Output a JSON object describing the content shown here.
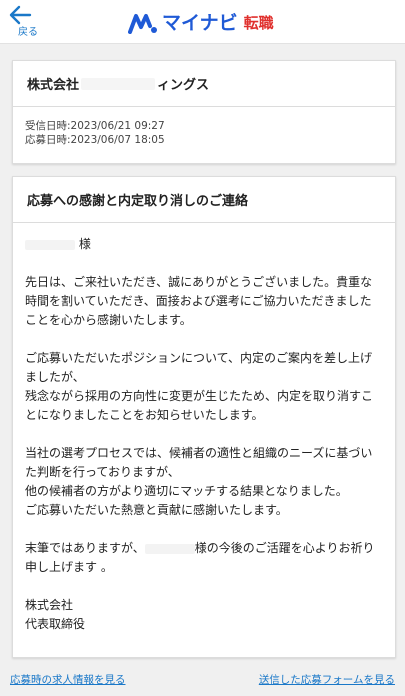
{
  "header": {
    "back_label": "戻る",
    "logo_brand": "マイナビ",
    "logo_sub": "転職",
    "brand_color": "#1f5ad6",
    "accent_color": "#e0302d",
    "icons": {
      "back": "arrow-left-icon",
      "logo": "mynavi-mark-icon"
    }
  },
  "summary": {
    "company_prefix": "株式会社",
    "company_suffix": "ィングス",
    "received_label": "受信日時:2023/06/21 09:27",
    "applied_label": "応募日時:2023/06/07 18:05"
  },
  "message": {
    "subject": "応募への感謝と内定取り消しのご連絡",
    "salutation_suffix": "様",
    "paragraphs": [
      "先日は、ご来社いただき、誠にありがとうございました。貴重な時間を割いていただき、面接および選考にご協力いただきましたことを心から感謝いたします。",
      "ご応募いただいたポジションについて、内定のご案内を差し上げましたが、\n残念ながら採用の方向性に変更が生じたため、内定を取り消すことになりましたことをお知らせいたします。",
      "当社の選考プロセスでは、候補者の適性と組織のニーズに基づいた判断を行っておりますが、\n他の候補者の方がより適切にマッチする結果となりました。\nご応募いただいた熱意と貢献に感謝いたします。"
    ],
    "closing_before": "末筆ではありますが、",
    "closing_after": "様の今後のご活躍を心よりお祈り申し上げます 。",
    "signature_company": "株式会社",
    "signature_title": "代表取締役"
  },
  "footer": {
    "left_link": "応募時の求人情報を見る",
    "right_link": "送信した応募フォームを見る"
  }
}
